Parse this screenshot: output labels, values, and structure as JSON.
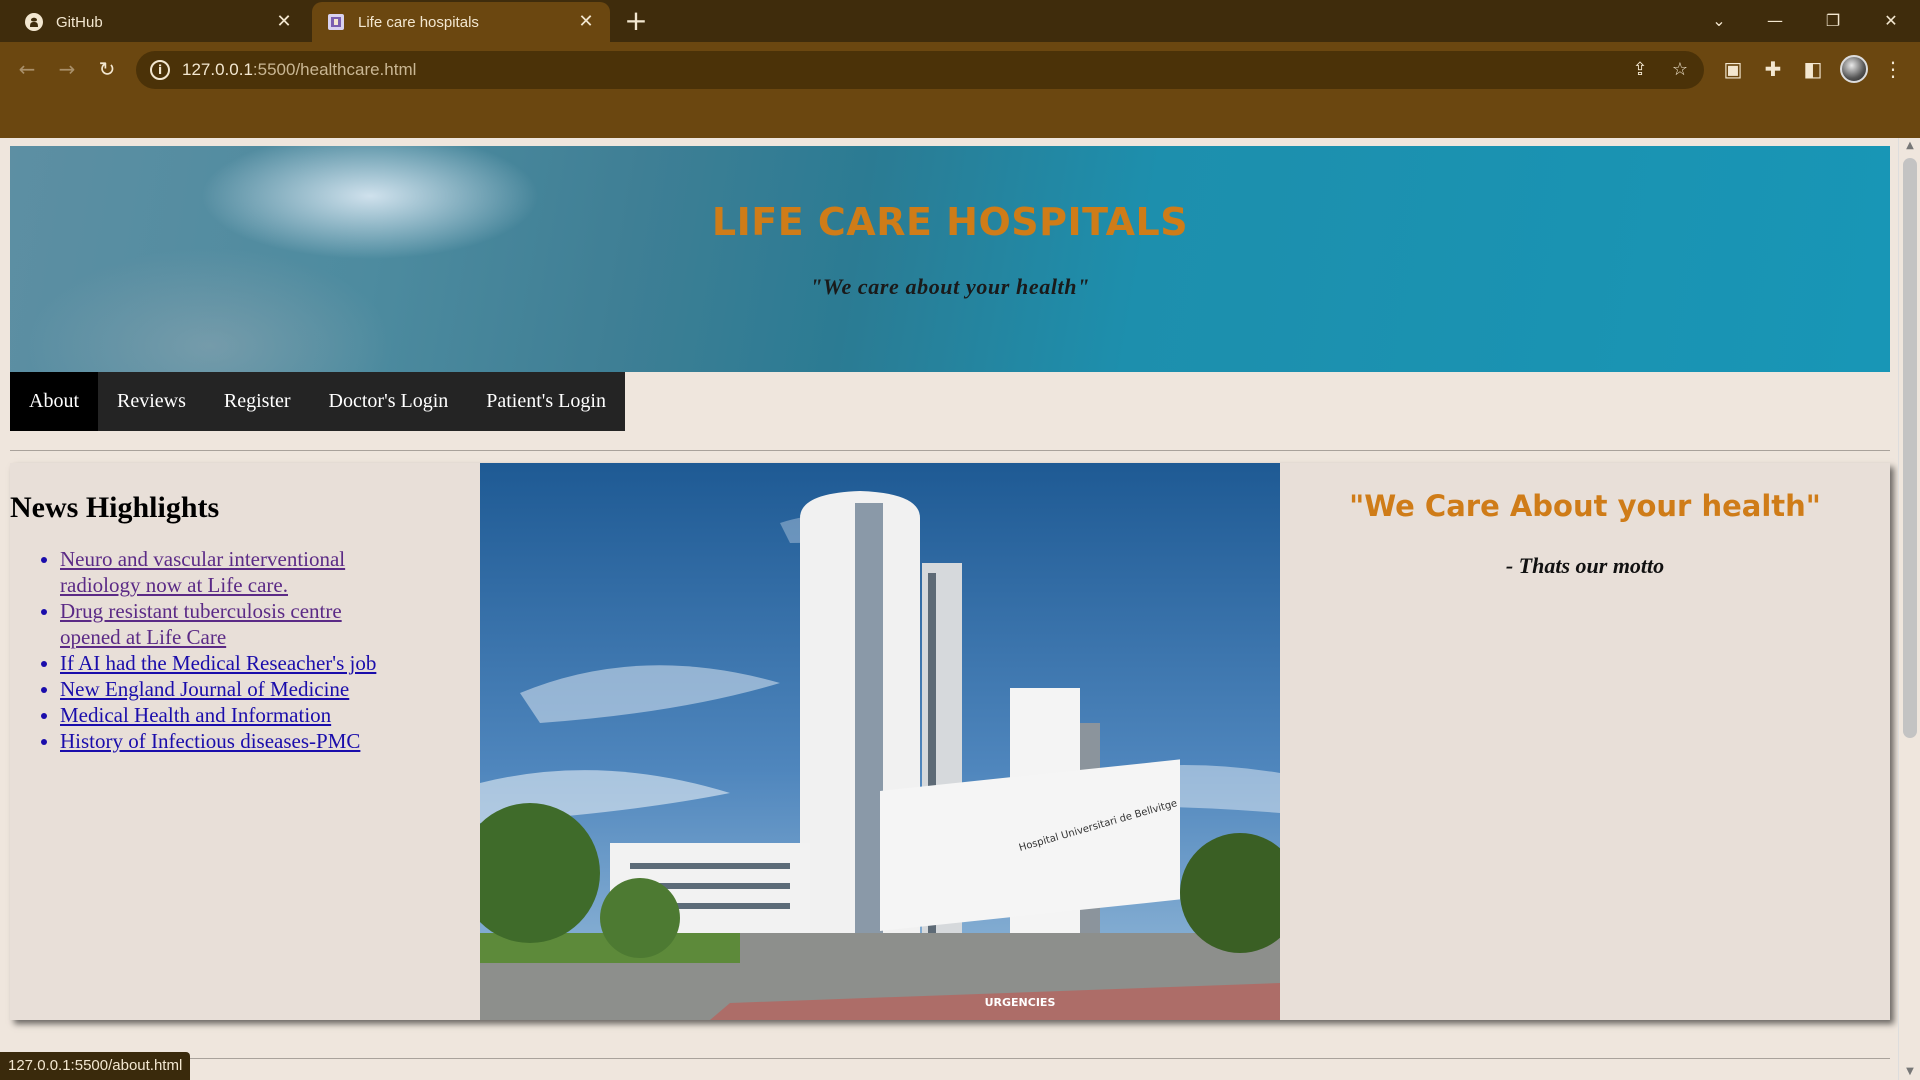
{
  "browser": {
    "tabs": [
      {
        "label": "GitHub",
        "icon": "github-icon"
      },
      {
        "label": "Life care hospitals",
        "icon": "site-favicon"
      }
    ],
    "url_host": "127.0.0.1",
    "url_rest": ":5500/healthcare.html",
    "status_url": "127.0.0.1:5500/about.html",
    "colors": {
      "chrome_dark": "#3f2c0c",
      "chrome": "#6b4710",
      "omnibox": "#4b3208"
    }
  },
  "header": {
    "title": "LIFE CARE HOSPITALS",
    "tagline": "\"We care about your health\""
  },
  "menu": {
    "items": [
      {
        "label": "About",
        "active": true
      },
      {
        "label": "Reviews"
      },
      {
        "label": "Register"
      },
      {
        "label": "Doctor's Login"
      },
      {
        "label": "Patient's Login"
      }
    ]
  },
  "news": {
    "heading": "News Highlights",
    "items": [
      {
        "label": "Neuro and vascular interventional radiology now at Life care.",
        "visited": true
      },
      {
        "label": "Drug resistant tuberculosis centre opened at Life Care",
        "visited": true
      },
      {
        "label": "If AI had the Medical Reseacher's job"
      },
      {
        "label": "New England Journal of Medicine"
      },
      {
        "label": "Medical Health and Information"
      },
      {
        "label": "History of Infectious diseases-PMC"
      }
    ]
  },
  "photo": {
    "sign_text": "Hospital Universitari de Bellvitge",
    "ground_text": "URGENCIES"
  },
  "motto": {
    "quote": "\"We Care About your health\"",
    "signature": "- Thats our motto"
  },
  "theme": {
    "accent": "#cf7c18",
    "page_bg": "#efe6dd",
    "nav_bg": "#242424",
    "link": "#1a0dab",
    "visited": "#5b2a86"
  }
}
